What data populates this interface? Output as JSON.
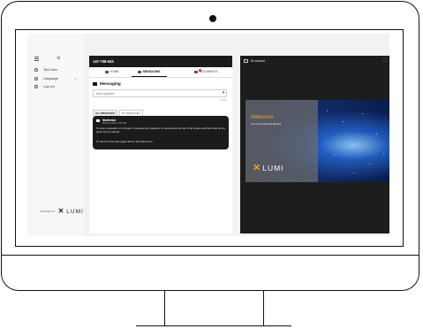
{
  "sidebar": {
    "items": [
      {
        "label": "Text User",
        "icon": "user-icon"
      },
      {
        "label": "Language",
        "icon": "globe-icon"
      },
      {
        "label": "Log out",
        "icon": "logout-icon"
      }
    ],
    "footer": {
      "powered_by": "POWERED BY",
      "brand": "LUMI"
    }
  },
  "main": {
    "meeting_id": "147-708-643",
    "tabs": [
      {
        "label": "HOME",
        "icon": "home-icon"
      },
      {
        "label": "MESSAGING",
        "icon": "messaging-icon"
      },
      {
        "label": "DOCUMENTS",
        "icon": "documents-icon"
      }
    ],
    "section_title": "Messaging",
    "input_placeholder": "Ask a question",
    "char_count": "0 / 4000",
    "filters": [
      "ALL MESSAGES",
      "MY MESSAGES"
    ],
    "message": {
      "sender": "Moderator",
      "time": "March 20 2023 10:07 AM",
      "body1": "To enter a question or comment, compose your question or comment at the top of the screen and then click on the arrow icon to submit.",
      "body2": "To return to the main page click on the Home icon."
    }
  },
  "broadcast": {
    "title": "Broadcast",
    "welcome_title": "Welcome",
    "welcome_subtitle": "Lumi Annual General Meeting",
    "brand": "LUMI"
  },
  "colors": {
    "accent": "#f4a41c",
    "header_dark": "#1b1b1b",
    "notification": "#e03030"
  }
}
